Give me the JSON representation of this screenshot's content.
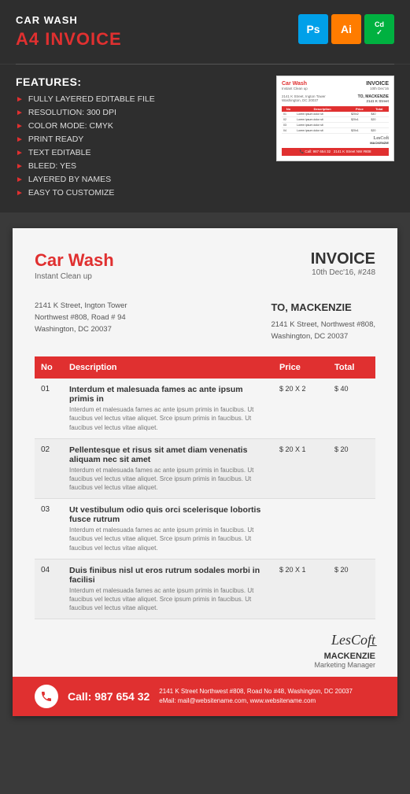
{
  "header": {
    "title": "CAR WASH",
    "subtitle": "A4 INVOICE",
    "badges": [
      {
        "label": "Ps",
        "type": "ps"
      },
      {
        "label": "Ai",
        "type": "ai"
      },
      {
        "label": "Cd",
        "type": "cd"
      }
    ]
  },
  "features": {
    "title": "FEATURES:",
    "items": [
      "FULLY LAYERED EDITABLE FILE",
      "RESOLUTION: 300 DPI",
      "COLOR MODE: CMYK",
      "PRINT READY",
      "TEXT EDITABLE",
      "BLEED: YES",
      "LAYERED BY NAMES",
      "EASY TO CUSTOMIZE"
    ]
  },
  "invoice": {
    "brand": "Car Wash",
    "brand_sub": "Instant Clean up",
    "label": "INVOICE",
    "date": "10th Dec'16, #248",
    "from_address": "2141 K Street, Ington Tower\nNorthwest #808, Road # 94\nWashington, DC 20037",
    "to_label": "TO, MACKENZIE",
    "to_address": "2141 K Street, Northwest #808,\nWashington, DC 20037",
    "table": {
      "headers": [
        "No",
        "Description",
        "Price",
        "Total"
      ],
      "rows": [
        {
          "no": "01",
          "title": "Interdum et malesuada fames ac ante ipsum primis in",
          "desc": "Interdum et malesuada fames ac ante ipsum primis in faucibus. Ut faucibus vel lectus vitae aliquet. Srce ipsum primis in faucibus. Ut faucibus vel lectus vitae aliquet.",
          "price": "$ 20 X 2",
          "total": "$ 40"
        },
        {
          "no": "02",
          "title": "Pellentesque et risus sit amet diam venenatis aliquam nec sit amet",
          "desc": "Interdum et malesuada fames ac ante ipsum primis in faucibus. Ut faucibus vel lectus vitae aliquet. Srce ipsum primis in faucibus. Ut faucibus vel lectus vitae aliquet.",
          "price": "$ 20 X 1",
          "total": "$ 20"
        },
        {
          "no": "03",
          "title": "Ut vestibulum odio quis orci scelerisque lobortis fusce rutrum",
          "desc": "Interdum et malesuada fames ac ante ipsum primis in faucibus. Ut faucibus vel lectus vitae aliquet. Srce ipsum primis in faucibus. Ut faucibus vel lectus vitae aliquet.",
          "price": "",
          "total": ""
        },
        {
          "no": "04",
          "title": "Duis finibus nisl ut eros rutrum sodales morbi in facilisi",
          "desc": "Interdum et malesuada fames ac ante ipsum primis in faucibus. Ut faucibus vel lectus vitae aliquet. Srce ipsum primis in faucibus. Ut faucibus vel lectus vitae aliquet.",
          "price": "$ 20 X 1",
          "total": "$ 20"
        }
      ]
    },
    "signature": "LesCoft",
    "sig_name": "MACKENZIE",
    "sig_title": "Marketing Manager",
    "footer_call": "Call: 987 654 32",
    "footer_contact": "2141 K Street Northwest #808, Road No #48, Washington, DC 20037\neMail: mail@websitename.com, www.websitename.com"
  }
}
